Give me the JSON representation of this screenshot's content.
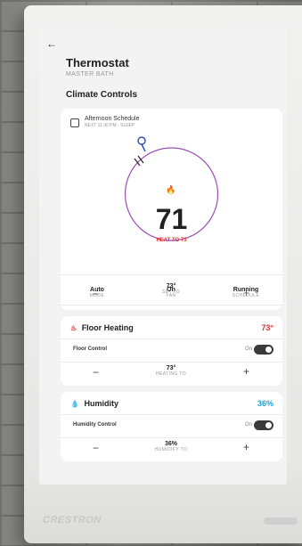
{
  "header": {
    "back_icon": "←",
    "title": "Thermostat",
    "subtitle": "MASTER BATH",
    "section_title": "Climate Controls"
  },
  "schedule": {
    "title": "Afternoon Schedule",
    "subtitle": "NEXT 11:30 PM - SLEEP"
  },
  "thermostat": {
    "current_temp": "71",
    "heat_to": "HEAT TO 73",
    "setpoint_value": "73°",
    "setpoint_label": "SET TO",
    "decrement": "−",
    "increment": "+"
  },
  "modes": [
    {
      "value": "Auto",
      "label": "MODE"
    },
    {
      "value": "On",
      "label": "FAN"
    },
    {
      "value": "Running",
      "label": "SCHEDULE"
    }
  ],
  "floor_heating": {
    "title": "Floor Heating",
    "value": "73°",
    "control_label": "Floor Control",
    "toggle_state": "On",
    "target_value": "73°",
    "target_label": "HEATING TO",
    "decrement": "−",
    "increment": "+"
  },
  "humidity": {
    "title": "Humidity",
    "value": "36%",
    "control_label": "Humidity Control",
    "toggle_state": "On",
    "target_value": "36%",
    "target_label": "HUMIDIFY TO",
    "decrement": "−",
    "increment": "+"
  },
  "device": {
    "brand": "CRESTRON"
  },
  "colors": {
    "heat": "#e03030",
    "humidity": "#1aa3d9",
    "dial_ring": "#9c4fb5"
  }
}
